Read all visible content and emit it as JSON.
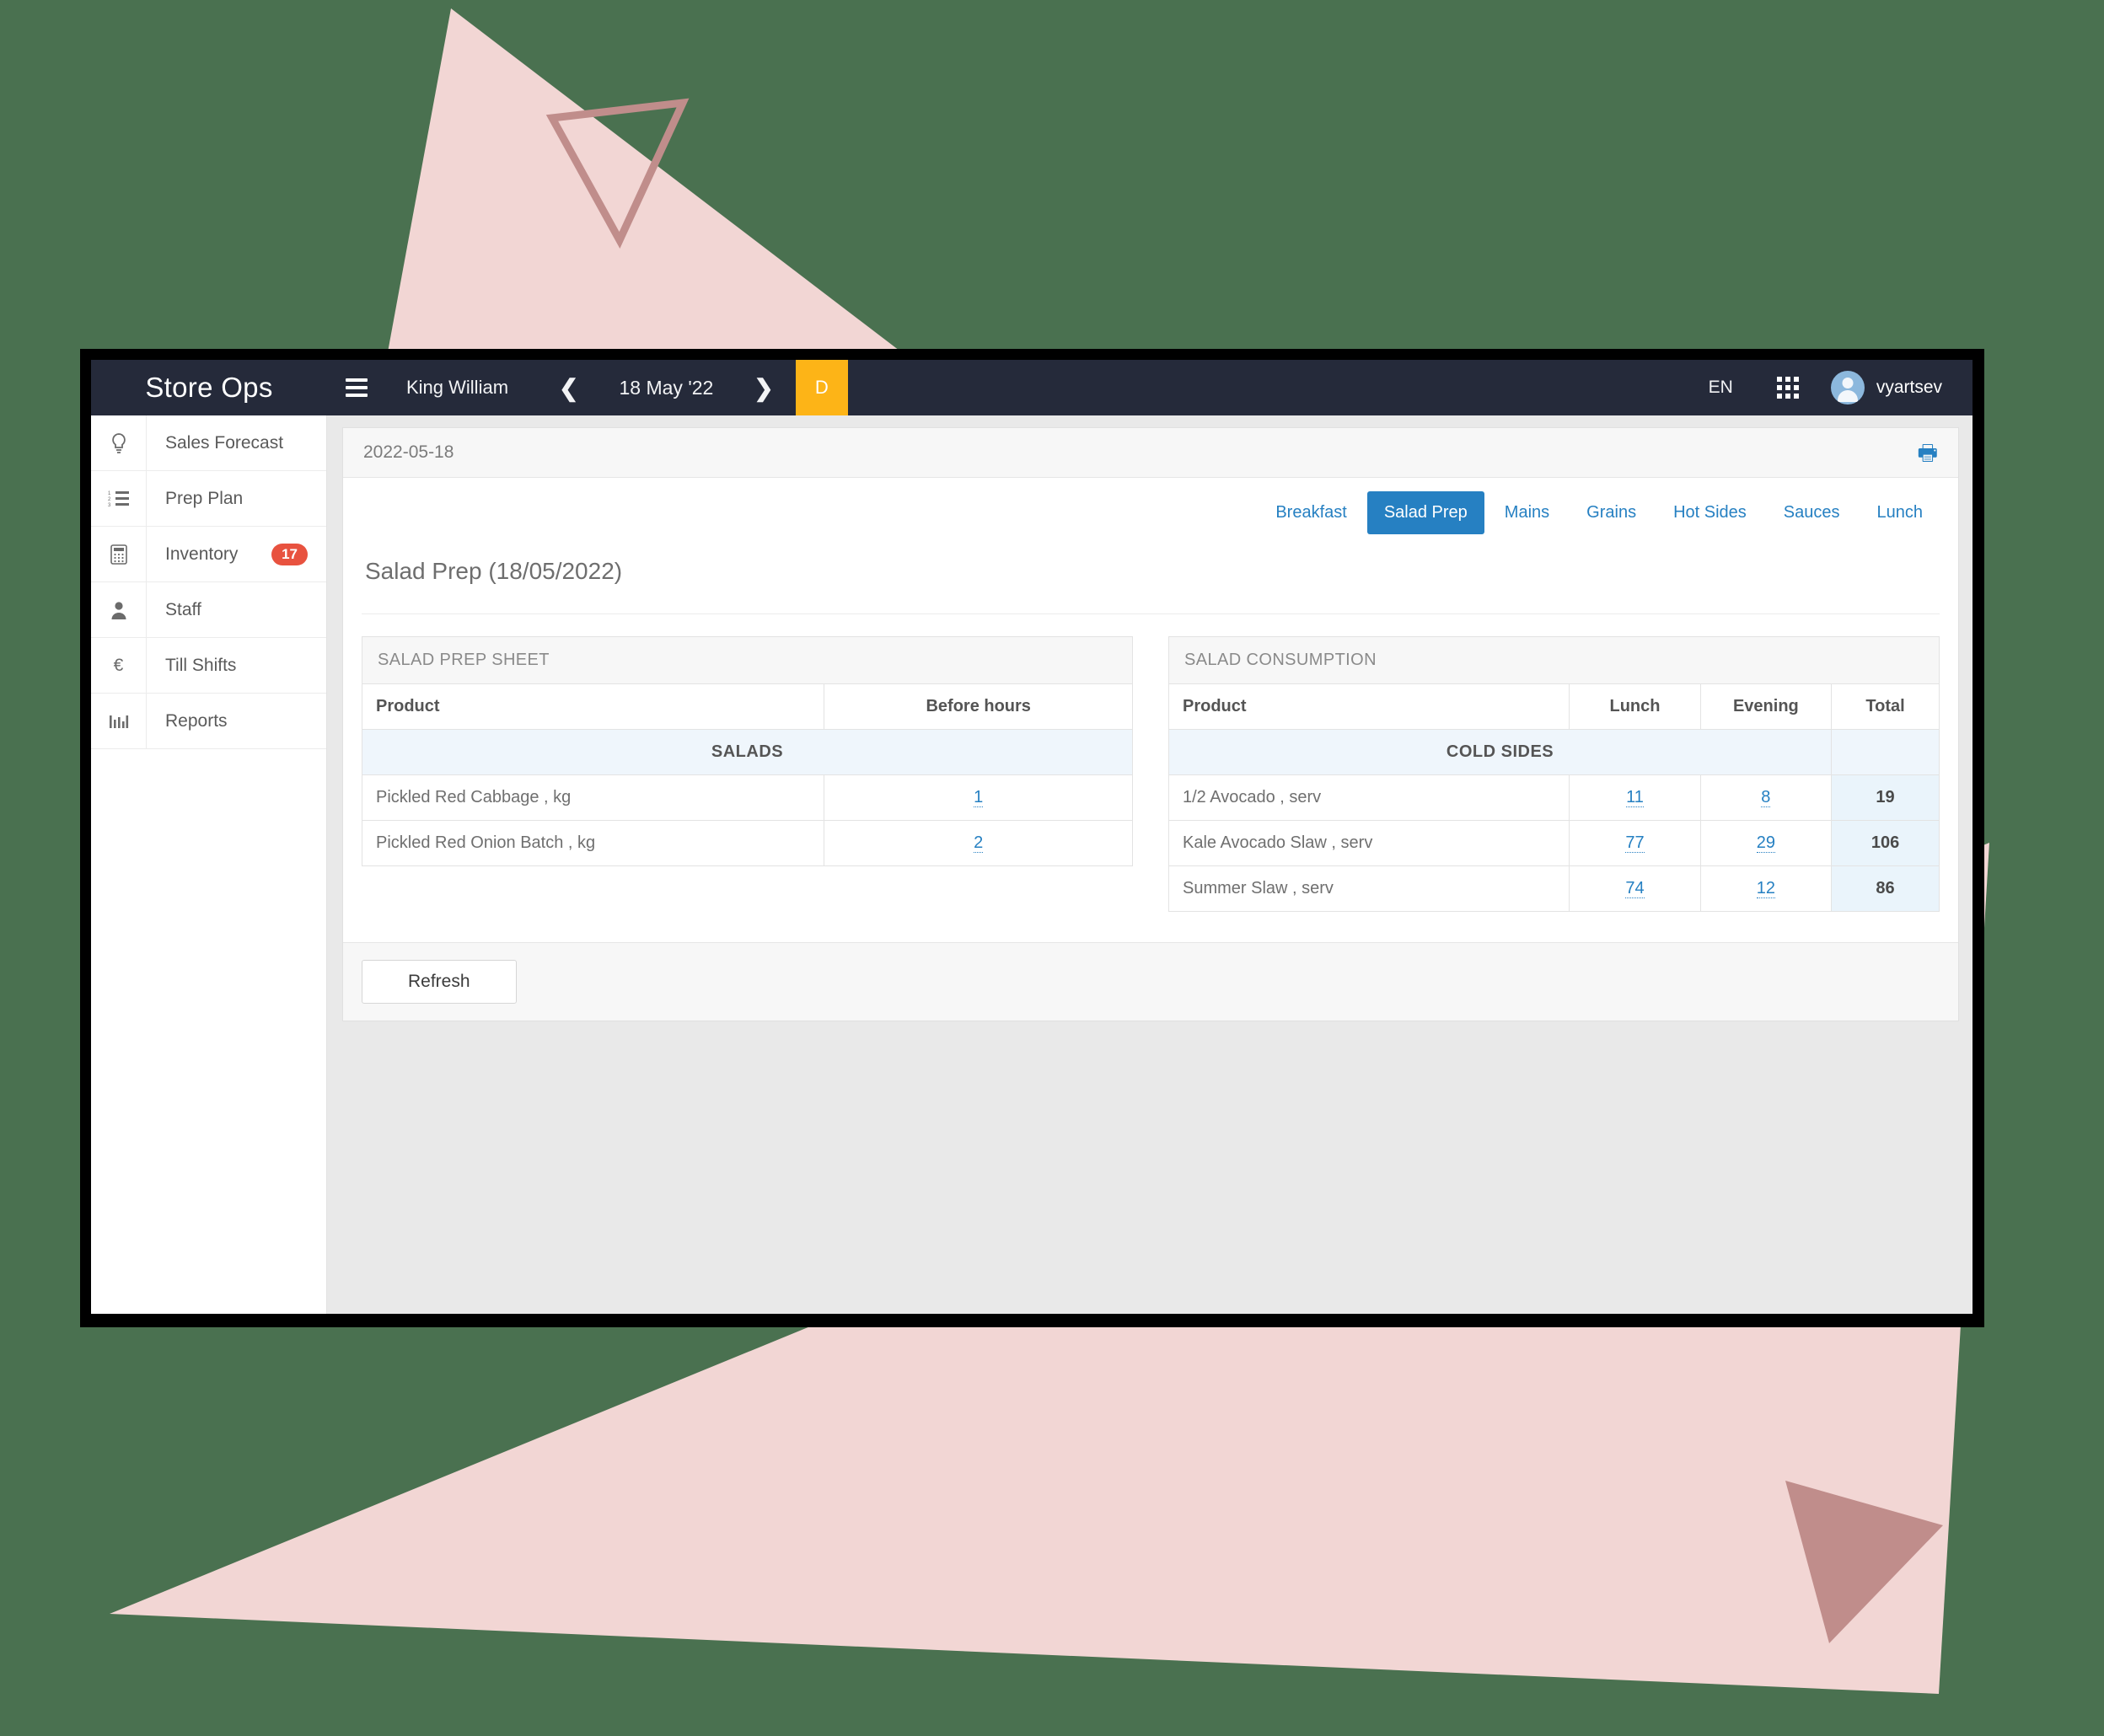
{
  "navbar": {
    "brand": "Store Ops",
    "menu_icon": "hamburger-icon",
    "store": "King William",
    "prev_icon": "chevron-left-icon",
    "date": "18 May '22",
    "next_icon": "chevron-right-icon",
    "day_badge": "D",
    "language": "EN",
    "apps_icon": "grid-icon",
    "avatar_icon": "user-avatar-icon",
    "username": "vyartsev"
  },
  "sidebar": {
    "items": [
      {
        "label": "Sales Forecast",
        "icon": "lightbulb-icon",
        "badge": ""
      },
      {
        "label": "Prep Plan",
        "icon": "ordered-list-icon",
        "badge": ""
      },
      {
        "label": "Inventory",
        "icon": "calculator-icon",
        "badge": "17"
      },
      {
        "label": "Staff",
        "icon": "person-icon",
        "badge": ""
      },
      {
        "label": "Till Shifts",
        "icon": "euro-icon",
        "badge": ""
      },
      {
        "label": "Reports",
        "icon": "bar-chart-icon",
        "badge": ""
      }
    ]
  },
  "card": {
    "header_date": "2022-05-18",
    "print_icon": "printer-icon",
    "page_title": "Salad Prep (18/05/2022)",
    "refresh_label": "Refresh"
  },
  "tabs": [
    {
      "label": "Breakfast",
      "active": false
    },
    {
      "label": "Salad Prep",
      "active": true
    },
    {
      "label": "Mains",
      "active": false
    },
    {
      "label": "Grains",
      "active": false
    },
    {
      "label": "Hot Sides",
      "active": false
    },
    {
      "label": "Sauces",
      "active": false
    },
    {
      "label": "Lunch",
      "active": false
    }
  ],
  "prep_sheet": {
    "title": "SALAD PREP SHEET",
    "columns": [
      "Product",
      "Before hours"
    ],
    "group": "SALADS",
    "rows": [
      {
        "product": "Pickled Red Cabbage , kg",
        "before_hours": "1"
      },
      {
        "product": "Pickled Red Onion Batch , kg",
        "before_hours": "2"
      }
    ]
  },
  "consumption": {
    "title": "SALAD CONSUMPTION",
    "columns": [
      "Product",
      "Lunch",
      "Evening",
      "Total"
    ],
    "group": "COLD SIDES",
    "rows": [
      {
        "product": "1/2 Avocado , serv",
        "lunch": "11",
        "evening": "8",
        "total": "19"
      },
      {
        "product": "Kale Avocado Slaw , serv",
        "lunch": "77",
        "evening": "29",
        "total": "106"
      },
      {
        "product": "Summer Slaw , serv",
        "lunch": "74",
        "evening": "12",
        "total": "86"
      }
    ]
  },
  "colors": {
    "background": "#4a7150",
    "navbar": "#252a3a",
    "accent_blue": "#2680c2",
    "badge_red": "#e8523f",
    "day_badge": "#fdb417",
    "shape_pink": "#f2d6d4",
    "shape_rose": "#c08d8b"
  }
}
